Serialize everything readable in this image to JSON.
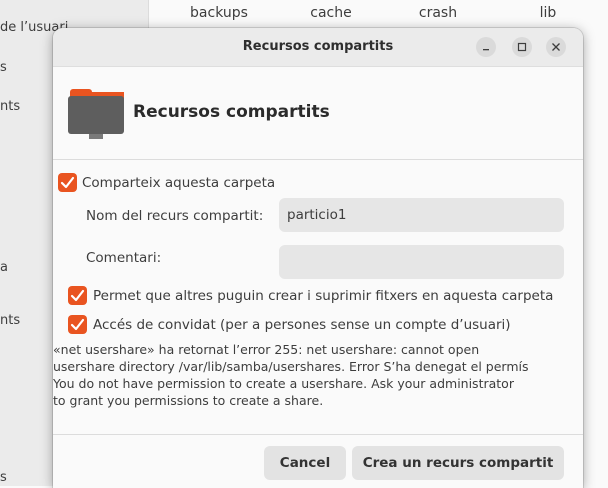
{
  "background": {
    "sidebar_items": [
      "de l’usuari",
      "s",
      "nts",
      "a",
      "nts",
      "s"
    ],
    "folders": [
      "backups",
      "cache",
      "crash",
      "lib"
    ]
  },
  "dialog": {
    "title": "Recursos compartits",
    "header_title": "Recursos compartits",
    "share_folder": {
      "label": "Comparteix aquesta carpeta",
      "checked": true
    },
    "share_name": {
      "label": "Nom del recurs compartit:",
      "value": "particio1"
    },
    "comment": {
      "label": "Comentari:",
      "value": ""
    },
    "allow_write": {
      "label": "Permet que altres puguin crear i suprimir fitxers en aquesta carpeta",
      "checked": true
    },
    "guest_access": {
      "label": "Accés de convidat (per a persones sense un compte d’usuari)",
      "checked": true
    },
    "error_lines": [
      "«net usershare» ha retornat l’error 255: net usershare: cannot open",
      "usershare directory /var/lib/samba/usershares. Error S’ha denegat el permís",
      "You do not have permission to create a usershare. Ask your administrator",
      "to grant you permissions to create a share."
    ],
    "cancel_label": "Cancel",
    "create_label": "Crea un recurs compartit"
  },
  "colors": {
    "accent": "#e95420",
    "folder": "#5e5e5e",
    "folder_tab": "#e95420"
  },
  "icons": [
    "minimize-icon",
    "maximize-icon",
    "close-icon",
    "folder-share-icon",
    "checkmark-icon"
  ]
}
